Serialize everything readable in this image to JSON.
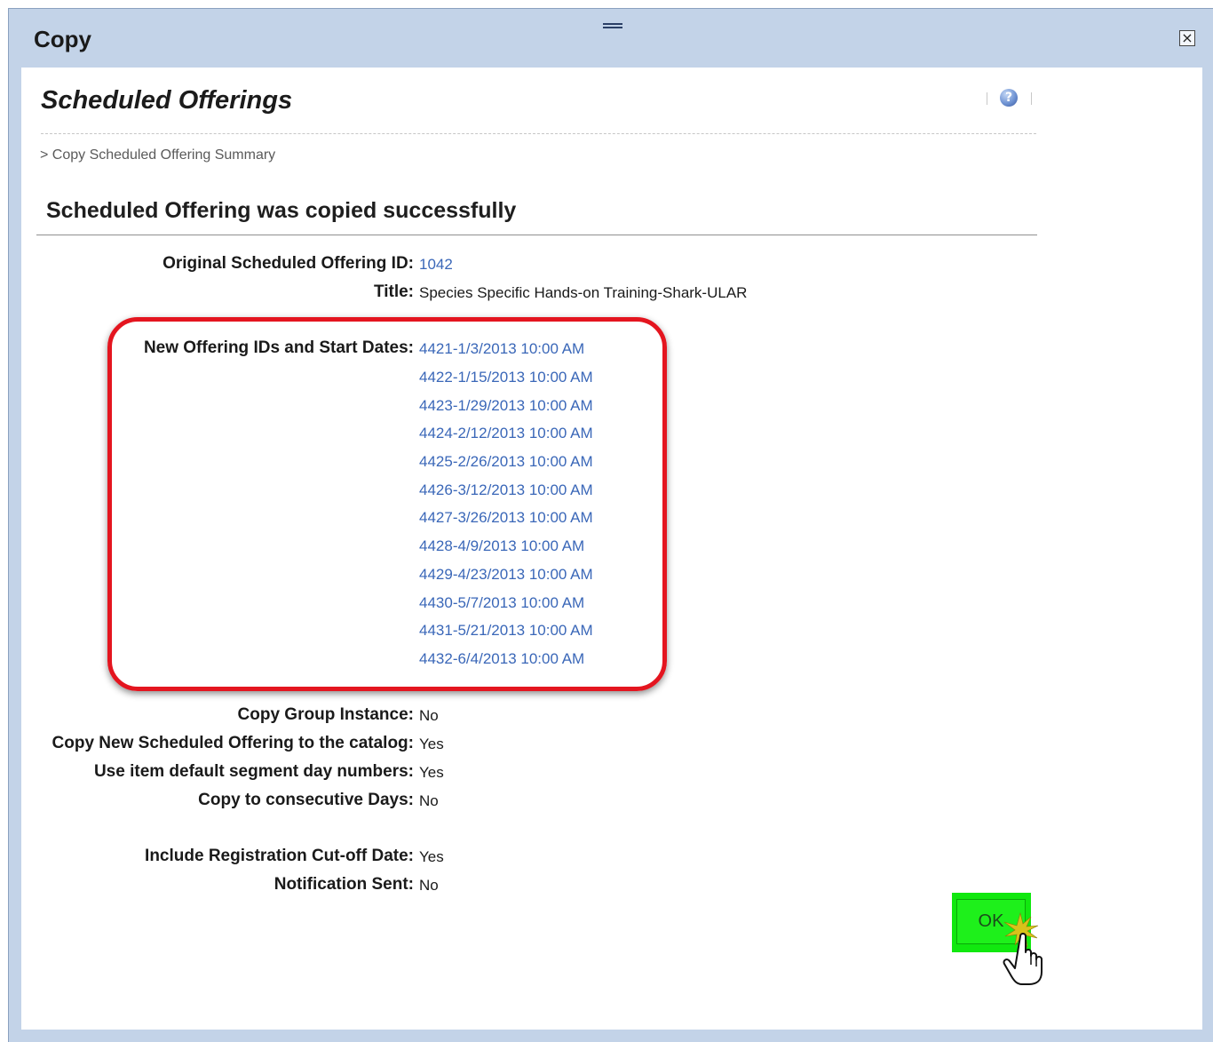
{
  "dialog": {
    "title": "Copy",
    "close_symbol": "×"
  },
  "page": {
    "title": "Scheduled Offerings",
    "help_symbol": "?",
    "breadcrumb": "> Copy Scheduled Offering Summary",
    "section_title": "Scheduled Offering was copied successfully"
  },
  "summary": {
    "original_id_label": "Original Scheduled Offering ID:",
    "original_id_value": "1042",
    "title_label": "Title:",
    "title_value": "Species Specific Hands-on Training-Shark-ULAR",
    "new_ids_label": "New Offering IDs and Start Dates:",
    "new_offerings": [
      "4421-1/3/2013 10:00 AM",
      "4422-1/15/2013 10:00 AM",
      "4423-1/29/2013 10:00 AM",
      "4424-2/12/2013 10:00 AM",
      "4425-2/26/2013 10:00 AM",
      "4426-3/12/2013 10:00 AM",
      "4427-3/26/2013 10:00 AM",
      "4428-4/9/2013 10:00 AM",
      "4429-4/23/2013 10:00 AM",
      "4430-5/7/2013 10:00 AM",
      "4431-5/21/2013 10:00 AM",
      "4432-6/4/2013 10:00 AM"
    ],
    "copy_group_label": "Copy Group Instance:",
    "copy_group_value": "No",
    "copy_catalog_label": "Copy New Scheduled Offering to the catalog:",
    "copy_catalog_value": "Yes",
    "use_default_label": "Use item default segment day numbers:",
    "use_default_value": "Yes",
    "consecutive_label": "Copy to consecutive Days:",
    "consecutive_value": "No",
    "cutoff_label": "Include Registration Cut-off Date:",
    "cutoff_value": "Yes",
    "notification_label": "Notification Sent:",
    "notification_value": "No"
  },
  "actions": {
    "ok_label": "OK"
  },
  "colors": {
    "highlight_border": "#e4151f",
    "ok_highlight": "#11e80f",
    "link": "#3a67b8",
    "frame": "#c3d3e8"
  },
  "icons": [
    "grip-icon",
    "close-icon",
    "help-icon",
    "hand-cursor-icon"
  ]
}
